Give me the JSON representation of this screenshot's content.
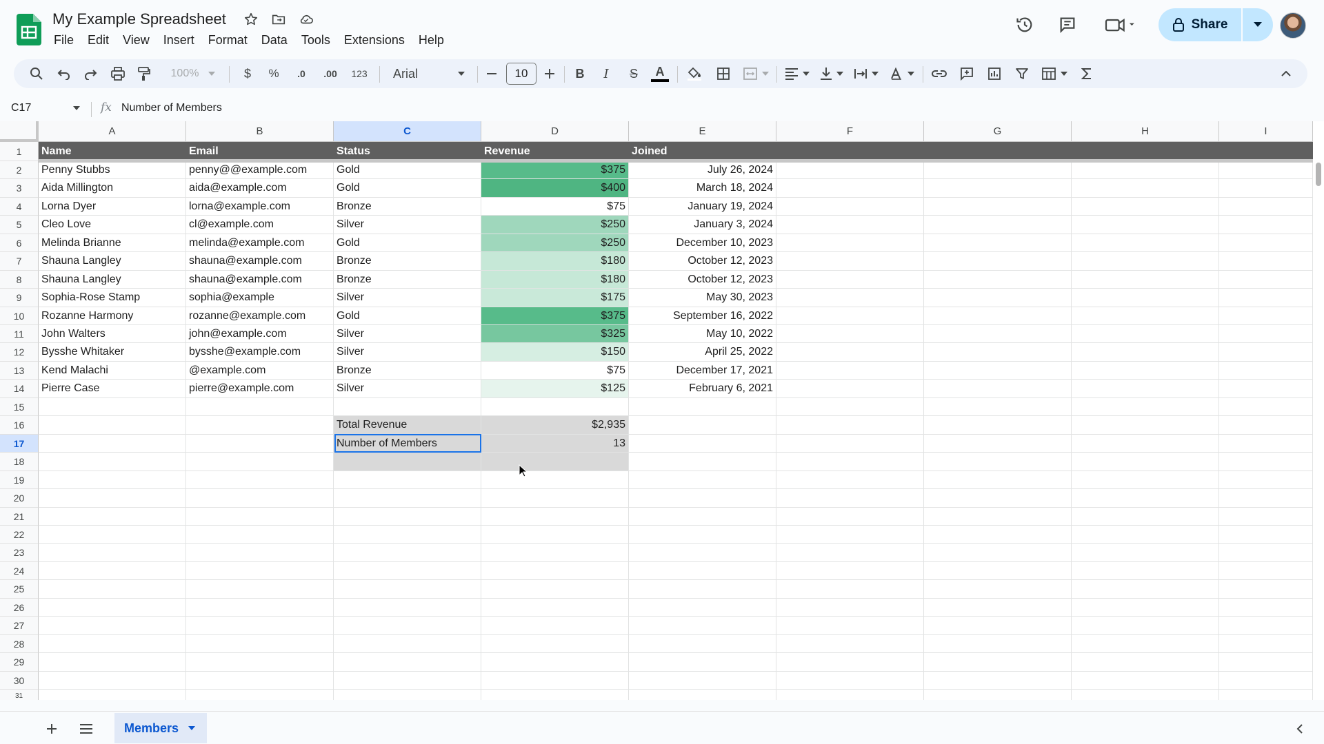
{
  "app": {
    "doc_title": "My Example Spreadsheet",
    "menu": [
      "File",
      "Edit",
      "View",
      "Insert",
      "Format",
      "Data",
      "Tools",
      "Extensions",
      "Help"
    ],
    "share_label": "Share",
    "colors": {
      "accent": "#0b57d0",
      "share_bg": "#c2e7ff",
      "header_row": "#5f5f5f",
      "total_bg": "#d9d9d9"
    }
  },
  "toolbar": {
    "zoom": "100%",
    "currency": "$",
    "percent": "%",
    "dec_decrease": ".0",
    "dec_increase": ".00",
    "number_format": "123",
    "font": "Arial",
    "font_size": "10",
    "bold": "B",
    "italic": "I",
    "strike": "S",
    "text_color": "A"
  },
  "formula_bar": {
    "cell_ref": "C17",
    "fx": "fx",
    "content": "Number of Members"
  },
  "columns": [
    "A",
    "B",
    "C",
    "D",
    "E",
    "F",
    "G",
    "H",
    "I"
  ],
  "selected_column": "C",
  "selected_row": 17,
  "rows": [
    1,
    2,
    3,
    4,
    5,
    6,
    7,
    8,
    9,
    10,
    11,
    12,
    13,
    14,
    15,
    16,
    17,
    18,
    19,
    20,
    21,
    22,
    23,
    24,
    25,
    26,
    27,
    28,
    29,
    30,
    31
  ],
  "header_row": [
    "Name",
    "Email",
    "Status",
    "Revenue",
    "Joined"
  ],
  "data_rows": [
    {
      "name": "Penny Stubbs",
      "email": "penny@@example.com",
      "status": "Gold",
      "revenue": "$375",
      "joined": "July 26, 2024",
      "shade": "#57bb8a"
    },
    {
      "name": "Aida Millington",
      "email": "aida@example.com",
      "status": "Gold",
      "revenue": "$400",
      "joined": "March 18, 2024",
      "shade": "#4fb582"
    },
    {
      "name": "Lorna Dyer",
      "email": "lorna@example.com",
      "status": "Bronze",
      "revenue": "$75",
      "joined": "January 19, 2024",
      "shade": "#ffffff"
    },
    {
      "name": "Cleo Love",
      "email": "cl@example.com",
      "status": "Silver",
      "revenue": "$250",
      "joined": "January 3, 2024",
      "shade": "#9fd7bc"
    },
    {
      "name": "Melinda Brianne",
      "email": "melinda@example.com",
      "status": "Gold",
      "revenue": "$250",
      "joined": "December 10, 2023",
      "shade": "#9fd7bc"
    },
    {
      "name": "Shauna Langley",
      "email": "shauna@example.com",
      "status": "Bronze",
      "revenue": "$180",
      "joined": "October 12, 2023",
      "shade": "#c6e8d7"
    },
    {
      "name": "Shauna Langley",
      "email": "shauna@example.com",
      "status": "Bronze",
      "revenue": "$180",
      "joined": "October 12, 2023",
      "shade": "#c6e8d7"
    },
    {
      "name": "Sophia-Rose Stamp",
      "email": "sophia@example",
      "status": "Silver",
      "revenue": "$175",
      "joined": "May 30, 2023",
      "shade": "#c9e9d9"
    },
    {
      "name": "Rozanne Harmony",
      "email": "rozanne@example.com",
      "status": "Gold",
      "revenue": "$375",
      "joined": "September 16, 2022",
      "shade": "#57bb8a"
    },
    {
      "name": "John Walters",
      "email": "john@example.com",
      "status": "Silver",
      "revenue": "$325",
      "joined": "May 10, 2022",
      "shade": "#77c79f"
    },
    {
      "name": "Bysshe Whitaker",
      "email": "bysshe@example.com",
      "status": "Silver",
      "revenue": "$150",
      "joined": "April 25, 2022",
      "shade": "#d6eee2"
    },
    {
      "name": "Kend Malachi",
      "email": "@example.com",
      "status": "Bronze",
      "revenue": "$75",
      "joined": "December 17, 2021",
      "shade": "#ffffff"
    },
    {
      "name": "Pierre Case",
      "email": "pierre@example.com",
      "status": "Silver",
      "revenue": "$125",
      "joined": "February 6, 2021",
      "shade": "#e6f4ed"
    }
  ],
  "summary": {
    "total_label": "Total Revenue",
    "total_value": "$2,935",
    "members_label": "Number of Members",
    "members_value": "13"
  },
  "sheet_tabs": [
    {
      "label": "Members",
      "active": true
    }
  ]
}
